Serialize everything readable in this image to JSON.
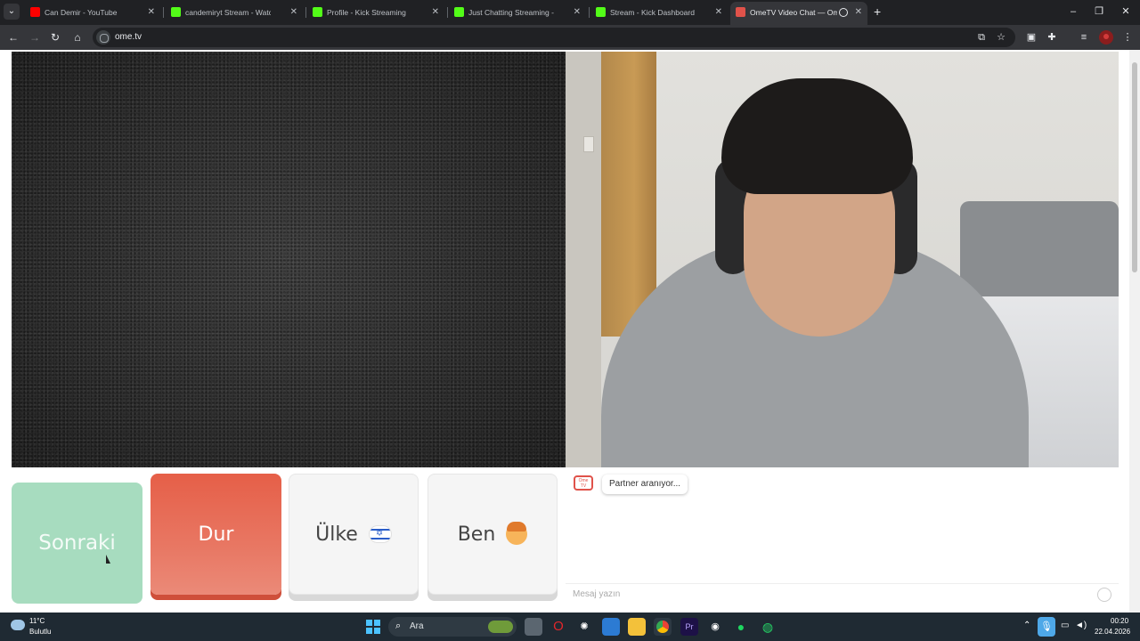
{
  "browser": {
    "tabs": [
      {
        "title": "Can Demir - YouTube",
        "favicon_color": "#ff0000"
      },
      {
        "title": "candemiryt Stream - Watch Live",
        "favicon_color": "#53fc18"
      },
      {
        "title": "Profile - Kick Streaming",
        "favicon_color": "#53fc18"
      },
      {
        "title": "Just Chatting Streaming - Live S",
        "favicon_color": "#53fc18"
      },
      {
        "title": "Stream - Kick Dashboard",
        "favicon_color": "#53fc18"
      },
      {
        "title": "OmeTV Video Chat — Ome",
        "favicon_color": "#e0524a"
      }
    ],
    "close_glyph": "✕",
    "new_tab_glyph": "+",
    "window_controls": {
      "minimize": "–",
      "maximize": "❐",
      "close": "✕"
    },
    "nav": {
      "back": "←",
      "forward": "→",
      "reload": "↻",
      "home": "⌂"
    },
    "url": "ome.tv",
    "toolbar_icons": [
      "install-icon",
      "star-icon",
      "extension-badge-icon",
      "puzzle-icon",
      "media-icon",
      "menu-icon"
    ]
  },
  "page": {
    "buttons": {
      "next": "Sonraki",
      "stop": "Dur",
      "country": "Ülke",
      "me": "Ben"
    },
    "chat": {
      "logo_text": "Ome TV",
      "status": "Partner aranıyor...",
      "message_placeholder": "Mesaj yazın"
    }
  },
  "taskbar": {
    "weather_temp": "11°C",
    "weather_desc": "Bulutlu",
    "search_placeholder": "Ara",
    "time": "00:20",
    "date": "22.04.2026"
  }
}
